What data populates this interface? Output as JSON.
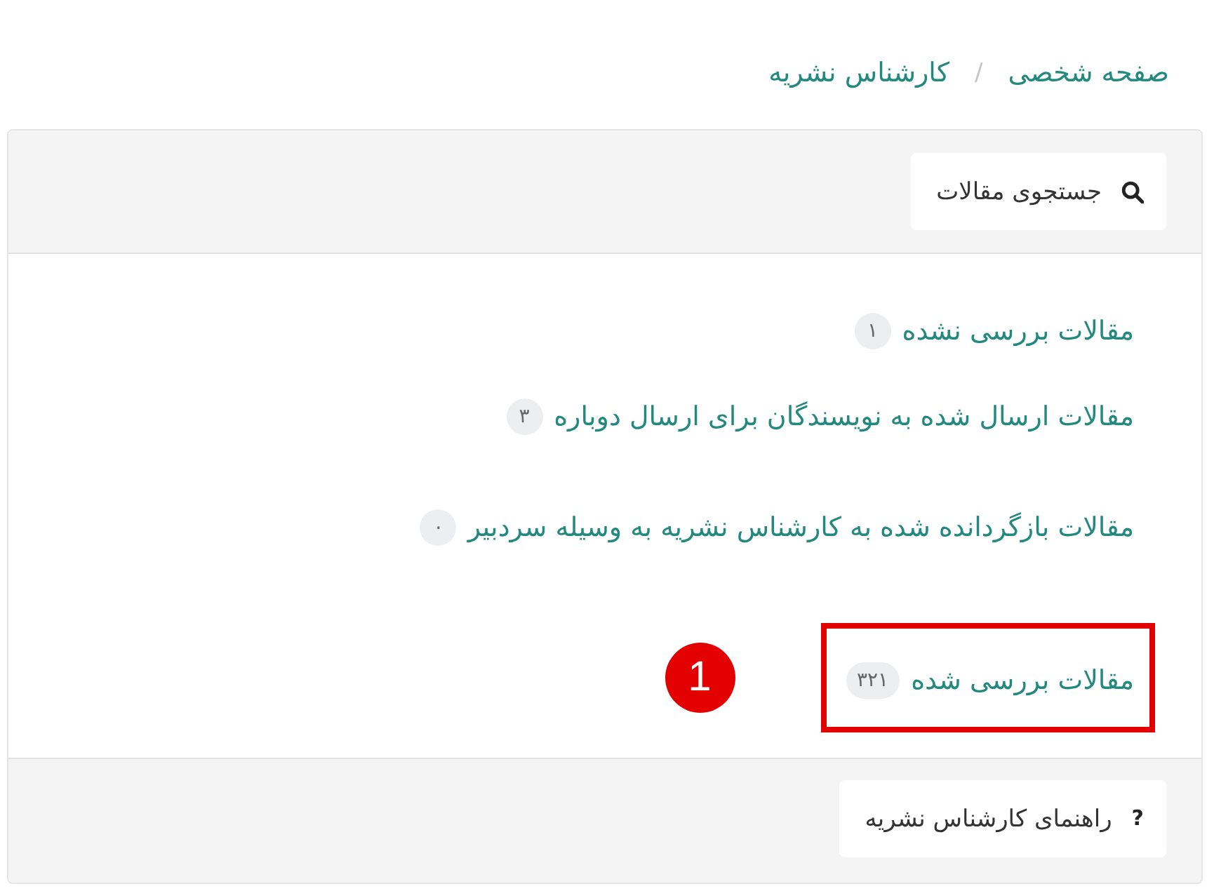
{
  "breadcrumb": {
    "items": [
      {
        "label": "صفحه شخصی"
      },
      {
        "label": "کارشناس نشریه"
      }
    ],
    "separator": "/"
  },
  "search_button": {
    "label": "جستجوی مقالات"
  },
  "categories": [
    {
      "label": "مقالات بررسی نشده",
      "count": "۱",
      "highlighted": false
    },
    {
      "label": "مقالات ارسال شده به نویسندگان برای ارسال دوباره",
      "count": "۳",
      "highlighted": false
    },
    {
      "label": "مقالات بازگردانده شده به کارشناس نشریه به وسیله سردبیر",
      "count": "۰",
      "highlighted": false
    },
    {
      "label": "مقالات بررسی شده",
      "count": "۳۲۱",
      "highlighted": true,
      "marker": "1"
    }
  ],
  "help_button": {
    "icon": "?",
    "label": "راهنمای کارشناس نشریه"
  }
}
